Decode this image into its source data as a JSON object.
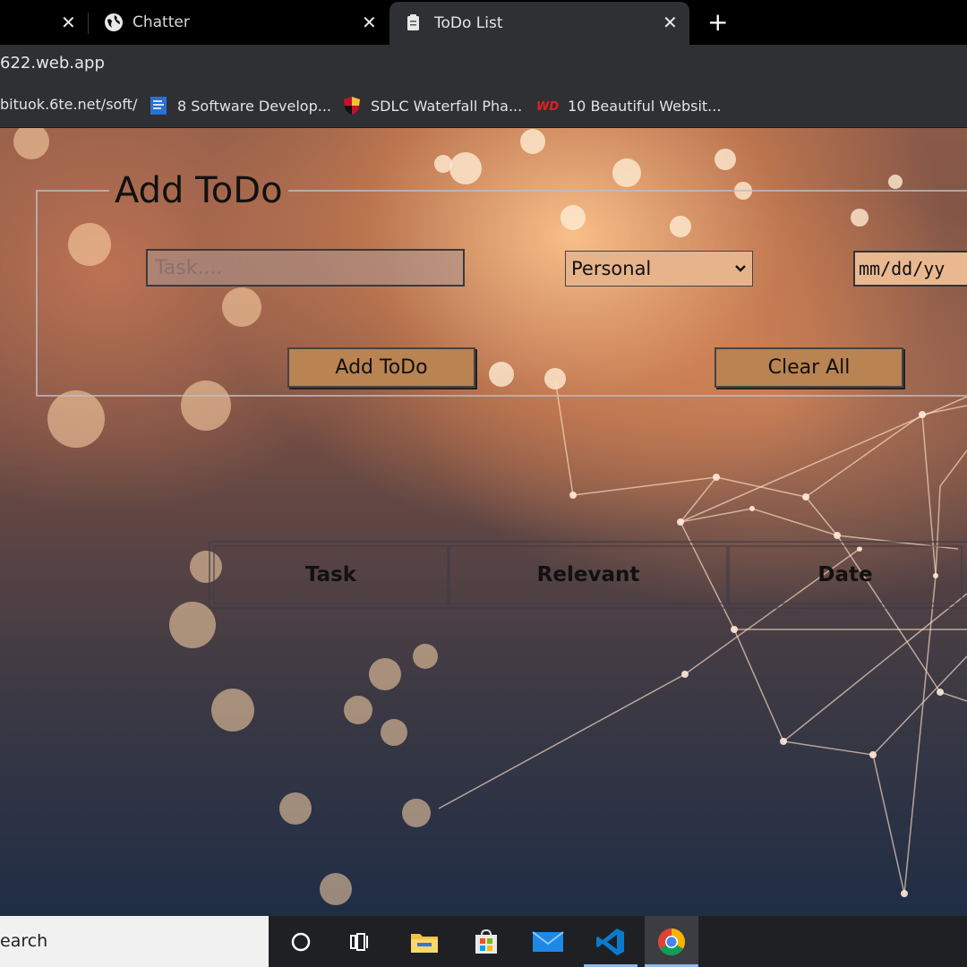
{
  "browser": {
    "tabs": [
      {
        "label": "",
        "active": false
      },
      {
        "label": "Chatter",
        "active": false
      },
      {
        "label": "ToDo List",
        "active": true
      }
    ],
    "url": "622.web.app",
    "bookmarks": [
      {
        "label": "bituok.6te.net/soft/",
        "icon": "none"
      },
      {
        "label": "8 Software Develop...",
        "icon": "blue-doc-icon"
      },
      {
        "label": "SDLC Waterfall Pha...",
        "icon": "shield-icon"
      },
      {
        "label": "10 Beautiful Websit...",
        "icon": "wd-icon"
      }
    ]
  },
  "form": {
    "legend": "Add ToDo",
    "task_placeholder": "Task....",
    "category_value": "Personal",
    "date_value": "mm/dd/yy",
    "add_label": "Add ToDo",
    "clear_label": "Clear All"
  },
  "table": {
    "headers": [
      "Task",
      "Relevant",
      "Date"
    ]
  },
  "taskbar": {
    "search_text": "earch",
    "apps": [
      "cortana-icon",
      "task-view-icon",
      "file-explorer-icon",
      "store-icon",
      "mail-icon",
      "vscode-icon",
      "chrome-icon"
    ]
  },
  "colors": {
    "button": "#b98352",
    "select_bg": "#e7b38b",
    "tab_active": "#2e3033"
  }
}
